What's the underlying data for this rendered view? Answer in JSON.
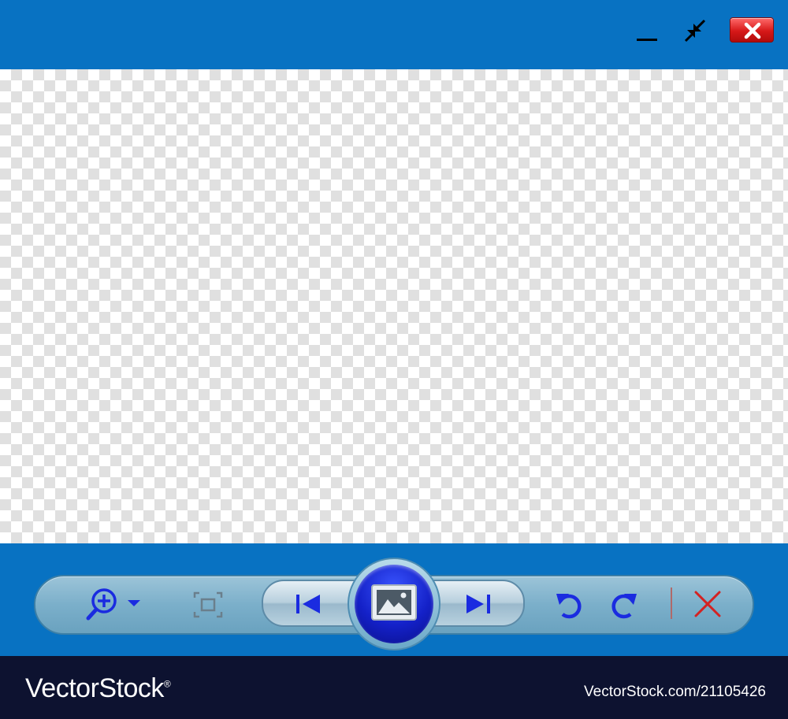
{
  "window": {
    "titlebar": {
      "buttons": [
        {
          "name": "minimize",
          "icon": "minimize-icon"
        },
        {
          "name": "restore",
          "icon": "restore-arrows-icon"
        },
        {
          "name": "close",
          "icon": "close-icon",
          "color": "#e42020"
        }
      ]
    },
    "canvas": {
      "pattern": "transparency-checkerboard",
      "colors": [
        "#ffffff",
        "#e0e0e0"
      ]
    },
    "colors": {
      "frame": "#0872c2",
      "icon_blue": "#1a2be0",
      "delete_red": "#d42222"
    }
  },
  "toolbar": {
    "tools": [
      {
        "name": "zoom-in",
        "icon": "zoom-in-icon",
        "has_dropdown": true
      },
      {
        "name": "fit-to-window",
        "icon": "fit-frame-icon"
      },
      {
        "name": "previous",
        "icon": "skip-previous-icon"
      },
      {
        "name": "slideshow",
        "icon": "image-icon"
      },
      {
        "name": "next",
        "icon": "skip-next-icon"
      },
      {
        "name": "rotate-left",
        "icon": "rotate-counterclockwise-icon"
      },
      {
        "name": "rotate-right",
        "icon": "rotate-clockwise-icon"
      },
      {
        "name": "delete",
        "icon": "delete-x-icon"
      }
    ]
  },
  "footer": {
    "brand": "VectorStock",
    "brand_mark": "®",
    "image_id": "VectorStock.com/21105426"
  }
}
